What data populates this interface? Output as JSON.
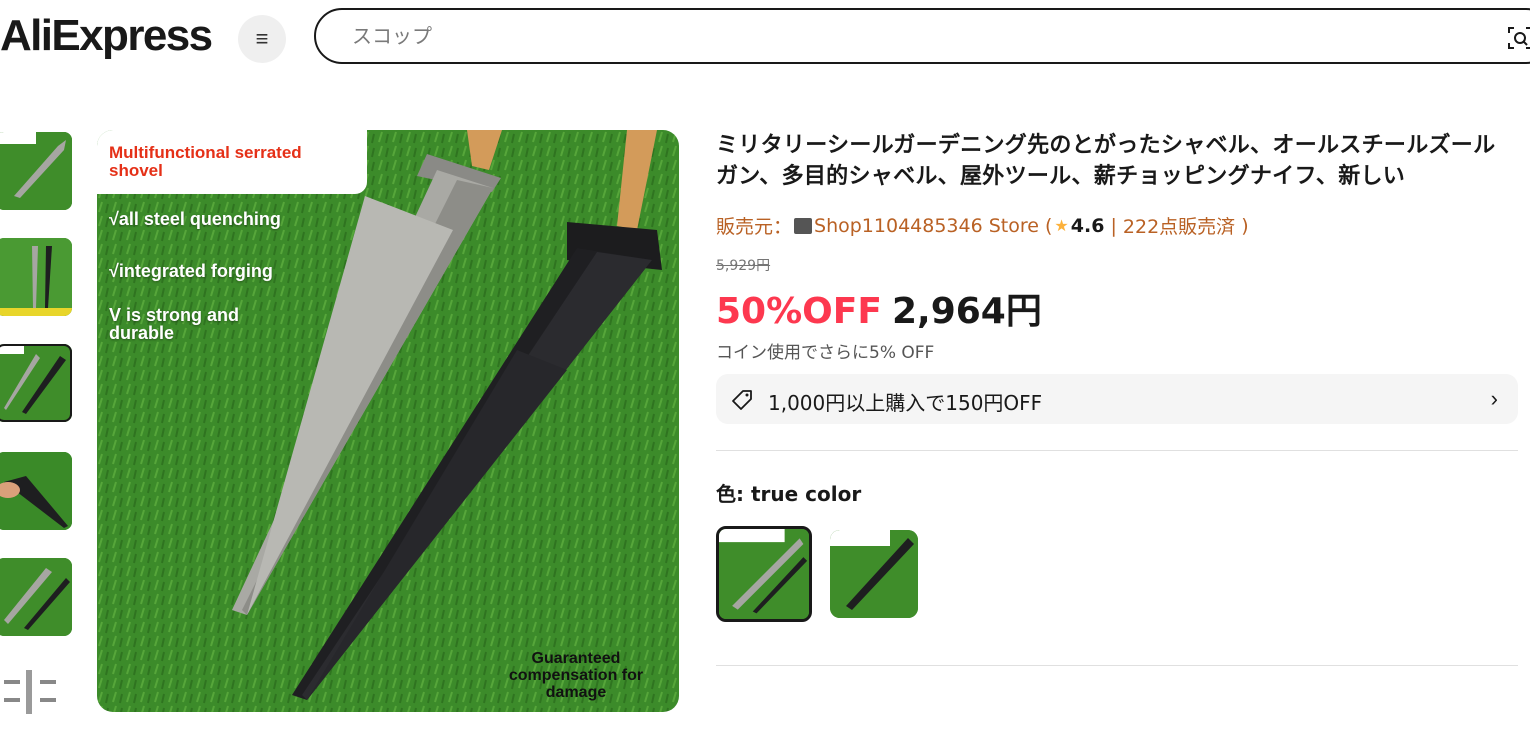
{
  "header": {
    "logo": "AliExpress",
    "menu_icon": "hamburger-menu-icon",
    "search_placeholder": "スコップ",
    "camera_icon": "camera-search-icon"
  },
  "gallery": {
    "thumbnails": [
      "thumb-1",
      "thumb-2",
      "thumb-3",
      "thumb-4",
      "thumb-5",
      "thumb-6"
    ],
    "active_index": 2,
    "main_image": {
      "label": "Multifunctional serrated shovel",
      "lines": [
        "√all steel quenching",
        "√integrated forging",
        "V is strong and durable"
      ],
      "bottom_text": "Guaranteed compensation for damage"
    }
  },
  "product": {
    "title": "ミリタリーシールガーデニング先のとがったシャベル、オールスチールズールガン、多目的シャベル、屋外ツール、薪チョッピングナイフ、新しい",
    "seller_prefix": "販売元：",
    "store_name": "Shop1104485346 Store",
    "rating": "4.6",
    "sold": "222点販売済",
    "original_price": "5,929円",
    "discount": "50%OFF",
    "price": "2,964円",
    "coin_note": "コイン使用でさらに5% OFF",
    "coupon": "1,000円以上購入で150円OFF",
    "color_label": "色: true color",
    "swatches": [
      "true color",
      "black"
    ]
  },
  "colors": {
    "accent_red": "#fd384f",
    "seller_brown": "#b96124",
    "grass_green": "#3e8a2b"
  }
}
